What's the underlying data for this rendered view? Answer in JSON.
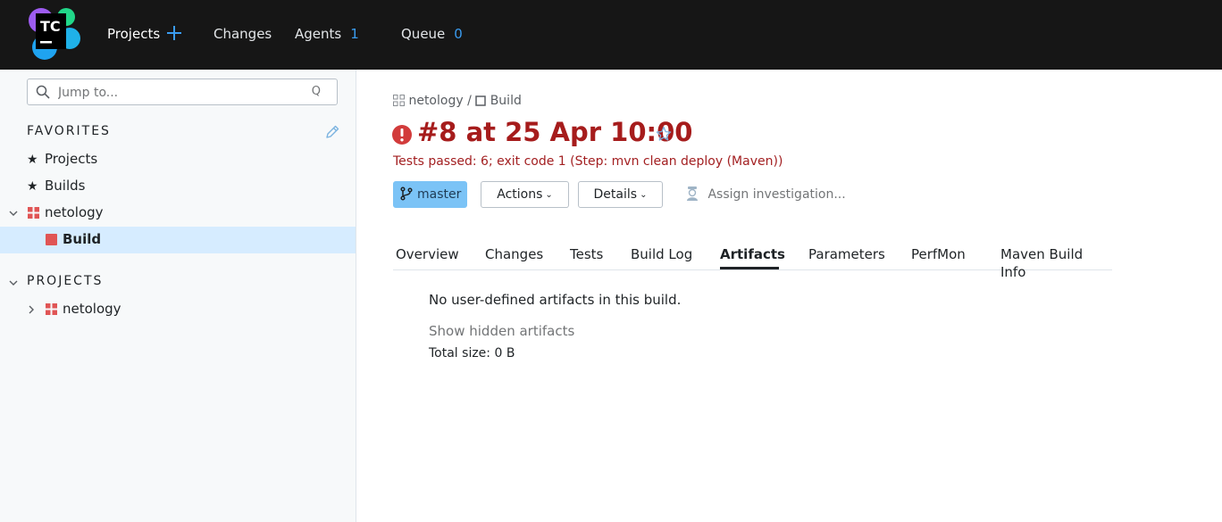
{
  "header": {
    "logo_text": "TC",
    "nav": {
      "projects": "Projects",
      "changes": "Changes",
      "agents": "Agents",
      "agents_count": "1",
      "queue": "Queue",
      "queue_count": "0"
    }
  },
  "sidebar": {
    "search_placeholder": "Jump to...",
    "search_shortcut": "Q",
    "favorites_title": "FAVORITES",
    "favorites": {
      "projects": "Projects",
      "builds": "Builds",
      "netology": "netology",
      "build": "Build"
    },
    "projects_title": "PROJECTS",
    "projects_tree": {
      "netology": "netology"
    }
  },
  "breadcrumb": {
    "project": "netology",
    "separator": "/",
    "build": "Build"
  },
  "build": {
    "title": "#8 at 25 Apr 10:00",
    "status": "Tests passed: 6; exit code 1 (Step: mvn clean deploy (Maven))",
    "branch": "master",
    "actions_label": "Actions",
    "details_label": "Details",
    "assign_label": "Assign investigation..."
  },
  "tabs": [
    "Overview",
    "Changes",
    "Tests",
    "Build Log",
    "Artifacts",
    "Parameters",
    "PerfMon",
    "Maven Build Info"
  ],
  "active_tab": "Artifacts",
  "artifacts": {
    "message": "No user-defined artifacts in this build.",
    "show_hidden": "Show hidden artifacts",
    "total_size": "Total size: 0 B"
  },
  "colors": {
    "header_bg": "#161616",
    "accent_blue": "#3a9cf0",
    "error_red": "#a61c1c",
    "branch_badge": "#7bc3f6",
    "selected_row": "#d6ecff"
  }
}
